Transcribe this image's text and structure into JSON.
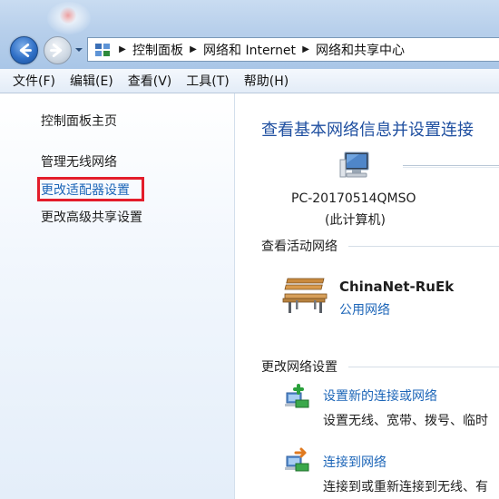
{
  "window": {
    "breadcrumbs": [
      "控制面板",
      "网络和 Internet",
      "网络和共享中心"
    ]
  },
  "menu": {
    "items": [
      "文件(F)",
      "编辑(E)",
      "查看(V)",
      "工具(T)",
      "帮助(H)"
    ]
  },
  "sidebar": {
    "home": "控制面板主页",
    "links": [
      "管理无线网络",
      "更改适配器设置",
      "更改高级共享设置"
    ],
    "highlighted": "更改适配器设置"
  },
  "main": {
    "title": "查看基本网络信息并设置连接",
    "computer_name": "PC-20170514QMSO",
    "computer_sub": "(此计算机)",
    "active_header": "查看活动网络",
    "network_name": "ChinaNet-RuEk",
    "network_type": "公用网络",
    "change_header": "更改网络设置",
    "tasks": [
      {
        "label": "设置新的连接或网络",
        "desc": "设置无线、宽带、拨号、临时"
      },
      {
        "label": "连接到网络",
        "desc": "连接到或重新连接到无线、有"
      }
    ]
  },
  "colors": {
    "link": "#1d66b8",
    "title": "#1f4fa0",
    "highlight_border": "#e31d2b"
  }
}
